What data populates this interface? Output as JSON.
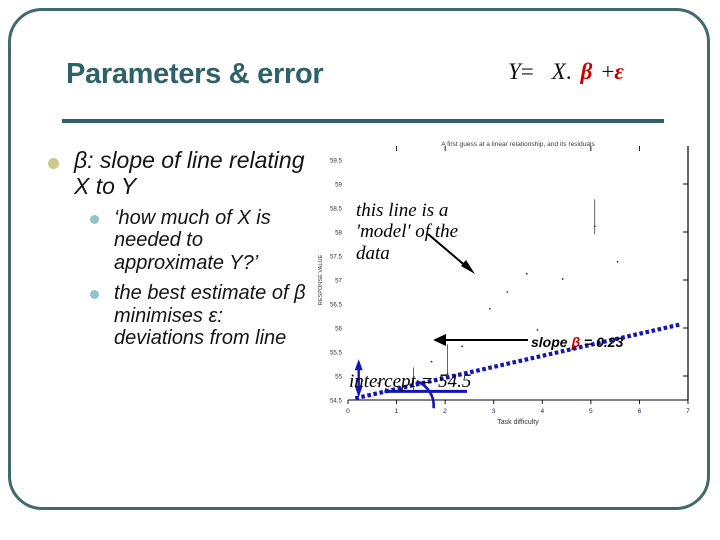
{
  "slide": {
    "title": "Parameters & error",
    "equation": {
      "lhs": "Y",
      "eq": "=",
      "x": "X",
      "dot": ".",
      "beta": "β",
      "plus": "+",
      "epsilon": "ε"
    },
    "accent_color": "#2F6168",
    "red_color": "#CC0000",
    "frame_color": "#41696E"
  },
  "bullets": {
    "level1": "β: slope of line relating X to Y",
    "level2": [
      "‘how much of X is needed to approximate Y?’",
      "the best estimate of β  minimises ε: deviations from line"
    ],
    "bullet_color_l1": "#C9C98E",
    "bullet_color_l2": "#8FC6C8"
  },
  "annotations": {
    "model": "this line is a 'model' of the data",
    "slope_prefix": "slope ",
    "slope_beta": "β",
    "slope_value": " = 0.23",
    "intercept": "intercept = 54.5"
  },
  "chart_data": {
    "type": "scatter",
    "title": "A first guess at a linear relationship, and its residuals",
    "xlabel": "Task difficulty",
    "ylabel": "RESPONSE VALUE",
    "xlim": [
      0,
      7
    ],
    "ylim": [
      54.5,
      59.5
    ],
    "xticks": [
      0,
      1,
      2,
      3,
      4,
      5,
      6,
      7
    ],
    "xticklabels": [
      "0",
      "1",
      "2",
      "3",
      "4",
      "5",
      "6",
      "7"
    ],
    "yticks": [
      54.5,
      55,
      55.5,
      56,
      56.5,
      57,
      57.5,
      58,
      58.5,
      59,
      59.5
    ],
    "yticklabels": [
      "54.5",
      "55",
      "55.5",
      "56",
      "56.5",
      "57",
      "57.5",
      "58",
      "58.5",
      "59",
      "59.5"
    ],
    "grid": false,
    "legend": null,
    "fit_line": {
      "name": "model (fitted line)",
      "style": "dotted",
      "color": "#1414B4",
      "intercept": 54.5,
      "slope": 0.23,
      "x_start": 0.15,
      "x_end": 6.85
    },
    "baseline": {
      "name": "intercept baseline",
      "color": "#1414B4",
      "y": 54.68,
      "x_start": 0.75,
      "x_end": 2.45
    },
    "angle_arc": {
      "name": "slope angle",
      "color": "#1414B4",
      "vertex_x": 1.35,
      "vertex_y": 54.87
    },
    "points": [
      {
        "x": 0.62,
        "y": 54.85
      },
      {
        "x": 0.78,
        "y": 54.73
      },
      {
        "x": 1.72,
        "y": 55.3
      },
      {
        "x": 2.05,
        "y": 55.04
      },
      {
        "x": 2.35,
        "y": 55.62
      },
      {
        "x": 2.92,
        "y": 56.4
      },
      {
        "x": 3.28,
        "y": 56.75
      },
      {
        "x": 3.68,
        "y": 57.13
      },
      {
        "x": 3.9,
        "y": 55.96
      },
      {
        "x": 4.42,
        "y": 57.02
      },
      {
        "x": 5.08,
        "y": 58.12
      },
      {
        "x": 5.55,
        "y": 57.38
      }
    ],
    "residuals": [
      {
        "x": 1.35,
        "y_top": 55.18,
        "y_bottom": 54.7
      },
      {
        "x": 2.05,
        "y_top": 55.66,
        "y_bottom": 55.04
      },
      {
        "x": 5.08,
        "y_top": 58.68,
        "y_bottom": 57.95
      }
    ]
  }
}
